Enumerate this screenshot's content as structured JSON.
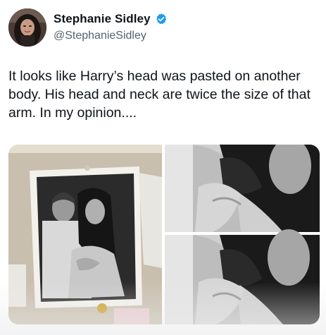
{
  "author": {
    "name": "Stephanie Sidley",
    "handle": "@StephanieSidley",
    "verified": true
  },
  "tweet": {
    "text": "It looks like Harry’s head was pasted on another body. His head and neck are twice the size of that arm. In my opinion...."
  },
  "colors": {
    "verified_blue": "#1d9bf0",
    "text_primary": "#0f1419",
    "text_secondary": "#536471"
  },
  "icons": {
    "verified": "verified-badge-icon"
  }
}
